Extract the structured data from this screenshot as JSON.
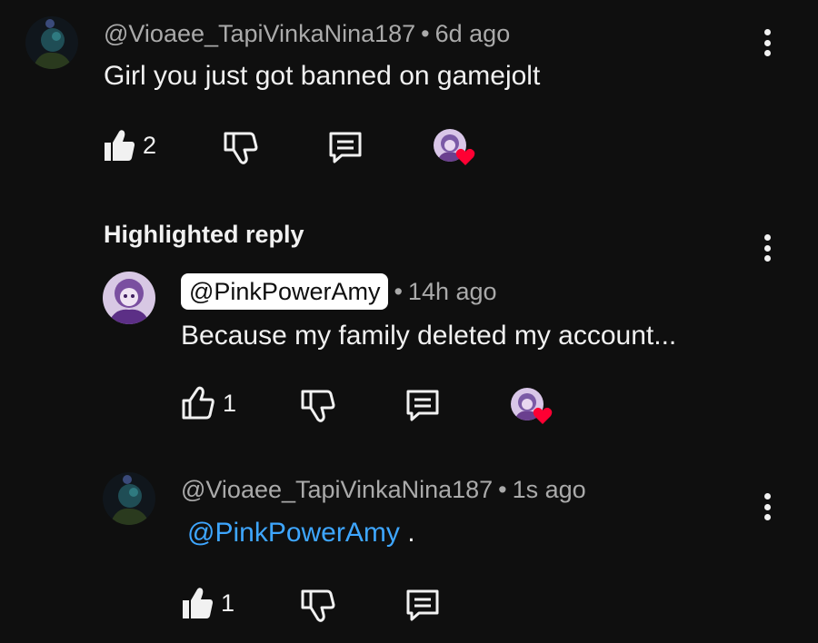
{
  "comment": {
    "author": "@Vioaee_TapiVinkaNina187",
    "separator": "•",
    "time": "6d ago",
    "text": "Girl you just got banned on gamejolt",
    "likes": "2"
  },
  "highlight_label": "Highlighted reply",
  "reply1": {
    "author": "@PinkPowerAmy",
    "separator": "•",
    "time": "14h ago",
    "text": "Because my family deleted my account...",
    "likes": "1"
  },
  "reply2": {
    "author": "@Vioaee_TapiVinkaNina187",
    "separator": "•",
    "time": "1s ago",
    "mention": "@PinkPowerAmy",
    "text_suffix": " .",
    "likes": "1"
  },
  "colors": {
    "background": "#0f0f0f",
    "text": "#f1f1f1",
    "meta": "#aaaaaa",
    "mention": "#3ea6ff",
    "heart": "#ff0033"
  }
}
